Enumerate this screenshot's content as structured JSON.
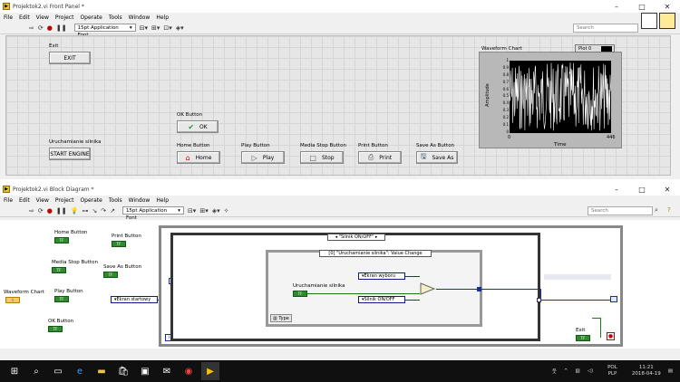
{
  "front_panel": {
    "title": "Projektok2.vi Front Panel *",
    "menu": [
      "File",
      "Edit",
      "View",
      "Project",
      "Operate",
      "Tools",
      "Window",
      "Help"
    ],
    "font": "15pt Application Font",
    "search_placeholder": "Search",
    "controls": {
      "exit": {
        "label": "Exit",
        "button": "EXIT"
      },
      "start": {
        "label": "Uruchamianie silnika",
        "button": "START ENGINE"
      },
      "ok": {
        "label": "OK Button",
        "button": "OK"
      },
      "home": {
        "label": "Home Button",
        "button": "Home"
      },
      "play": {
        "label": "Play Button",
        "button": "Play"
      },
      "stop": {
        "label": "Media Stop Button",
        "button": "Stop"
      },
      "print": {
        "label": "Print Button",
        "button": "Print"
      },
      "saveas": {
        "label": "Save As Button",
        "button": "Save As"
      }
    },
    "chart": {
      "title": "Waveform Chart",
      "legend": "Plot 0",
      "ylabel": "Amplitude",
      "xlabel": "Time",
      "x_start": "0",
      "x_end": "446",
      "y_ticks": [
        "1",
        "0.9",
        "0.8",
        "0.7",
        "0.6",
        "0.5",
        "0.4",
        "0.3",
        "0.2",
        "0.1",
        "0"
      ]
    }
  },
  "block_diagram": {
    "title": "Projektok2.vi Block Diagram *",
    "menu": [
      "File",
      "Edit",
      "View",
      "Project",
      "Operate",
      "Tools",
      "Window",
      "Help"
    ],
    "font": "15pt Application Font",
    "search_placeholder": "Search",
    "terminals": {
      "home": "Home Button",
      "print": "Print Button",
      "stop": "Media Stop Button",
      "saveas": "Save As Button",
      "chart": "Waveform Chart",
      "play": "Play Button",
      "ok": "OK Button",
      "start": "Uruchamianie silnika",
      "exit": "Exit"
    },
    "tf": "TF",
    "case_selector": "\"Silnik ON/OFF\"",
    "event_selector": "[0] \"Uruchamianie silnika\": Value Change",
    "enum_startowy": "Ekran startowy",
    "enum_wyboru": "Ekran wyboru",
    "enum_silnik": "Silnik ON/OFF",
    "type_label": "Type",
    "loop_index": "i"
  },
  "taskbar": {
    "lang": "POL",
    "sublang": "PLP",
    "time": "11:21",
    "date": "2018-04-19"
  }
}
